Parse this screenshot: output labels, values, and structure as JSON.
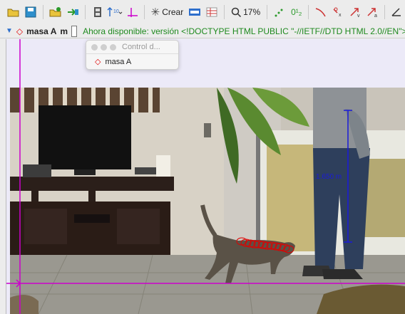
{
  "toolbar": {
    "crear_label": "Crear",
    "zoom_label": "17%",
    "ratio_label": "0¹₂"
  },
  "track_bar": {
    "mass_label": "masa A",
    "mass_unit_label": "m",
    "notice": "Ahora disponible: versión <!DOCTYPE HTML PUBLIC \"-//IETF//DTD HTML 2.0//EN\"> <html>"
  },
  "popup": {
    "title": "Control d...",
    "item_label": "masa A"
  },
  "overlay": {
    "measure_label": "1.650 m"
  },
  "colors": {
    "axis": "#cc00cc",
    "track": "#e00000",
    "measure": "#1a1ad9",
    "notice": "#1f8a1f"
  }
}
